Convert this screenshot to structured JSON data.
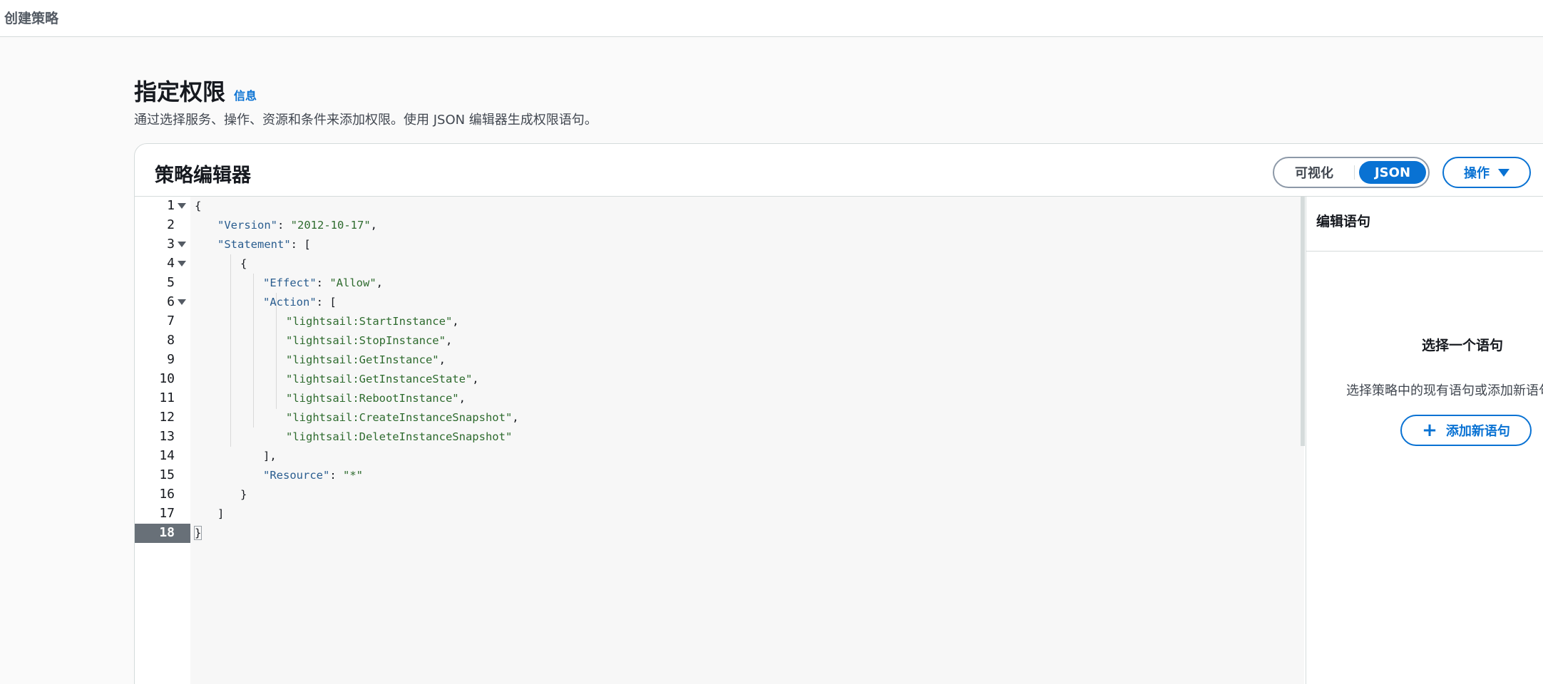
{
  "breadcrumb": "创建策略",
  "page": {
    "title": "指定权限",
    "info_link": "信息",
    "description": "通过选择服务、操作、资源和条件来添加权限。使用 JSON 编辑器生成权限语句。"
  },
  "editor_panel": {
    "title": "策略编辑器",
    "toggle": {
      "visual": "可视化",
      "json": "JSON",
      "selected": "JSON"
    },
    "actions_label": "操作"
  },
  "code": {
    "active_line": 18,
    "lines": [
      {
        "n": "1",
        "fold": true
      },
      {
        "n": "2",
        "fold": false
      },
      {
        "n": "3",
        "fold": true
      },
      {
        "n": "4",
        "fold": true
      },
      {
        "n": "5",
        "fold": false
      },
      {
        "n": "6",
        "fold": true
      },
      {
        "n": "7",
        "fold": false
      },
      {
        "n": "8",
        "fold": false
      },
      {
        "n": "9",
        "fold": false
      },
      {
        "n": "10",
        "fold": false
      },
      {
        "n": "11",
        "fold": false
      },
      {
        "n": "12",
        "fold": false
      },
      {
        "n": "13",
        "fold": false
      },
      {
        "n": "14",
        "fold": false
      },
      {
        "n": "15",
        "fold": false
      },
      {
        "n": "16",
        "fold": false
      },
      {
        "n": "17",
        "fold": false
      },
      {
        "n": "18",
        "fold": false
      }
    ],
    "tokens": {
      "l1": "{",
      "l2_key": "\"Version\"",
      "l2_sep": ": ",
      "l2_val": "\"2012-10-17\"",
      "l2_end": ",",
      "l3_key": "\"Statement\"",
      "l3_rest": ": [",
      "l4": "{",
      "l5_key": "\"Effect\"",
      "l5_sep": ": ",
      "l5_val": "\"Allow\"",
      "l5_end": ",",
      "l6_key": "\"Action\"",
      "l6_rest": ": [",
      "l7": "\"lightsail:StartInstance\"",
      "l8": "\"lightsail:StopInstance\"",
      "l9": "\"lightsail:GetInstance\"",
      "l10": "\"lightsail:GetInstanceState\"",
      "l11": "\"lightsail:RebootInstance\"",
      "l12": "\"lightsail:CreateInstanceSnapshot\"",
      "l13": "\"lightsail:DeleteInstanceSnapshot\"",
      "comma": ",",
      "l14": "],",
      "l15_key": "\"Resource\"",
      "l15_sep": ": ",
      "l15_val": "\"*\"",
      "l16": "}",
      "l17": "]",
      "l18": "}"
    }
  },
  "statement_panel": {
    "title": "编辑语句",
    "empty_title": "选择一个语句",
    "empty_desc": "选择策略中的现有语句或添加新语句。",
    "add_button": "添加新语句"
  },
  "colors": {
    "accent": "#0972d3",
    "json_key": "#2a5d8f",
    "json_string": "#2e6b2e",
    "active_gutter": "#687078"
  }
}
